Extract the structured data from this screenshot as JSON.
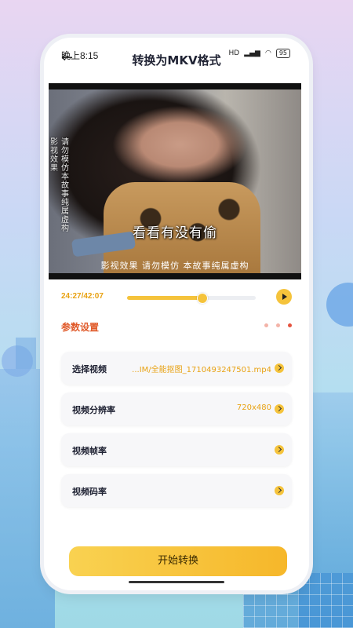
{
  "status_bar": {
    "time": "晚上8:15",
    "network": "HD",
    "signal_icons": [
      "signal-icon",
      "wifi-icon"
    ],
    "battery": "95"
  },
  "header": {
    "title": "转换为MKV格式"
  },
  "video": {
    "subtitle": "看看有没有偷",
    "vertical_text_1": "影视效果",
    "vertical_text_2": "请勿模仿本故事纯属虚构",
    "bottom_caption": "影视效果 请勿模仿 本故事纯属虚构"
  },
  "player": {
    "time": "24:27/42:07",
    "progress": 0.58
  },
  "settings": {
    "section_title": "参数设置",
    "rows": [
      {
        "label": "选择视频",
        "value": "...IM/全能抠图_1710493247501.mp4"
      },
      {
        "label": "视频分辨率",
        "value": "720x480"
      },
      {
        "label": "视频帧率",
        "value": ""
      },
      {
        "label": "视频码率",
        "value": ""
      }
    ]
  },
  "actions": {
    "start_label": "开始转换"
  },
  "colors": {
    "accent": "#f5c33b",
    "accent_text": "#e8a213",
    "section_title": "#e05a2a"
  }
}
